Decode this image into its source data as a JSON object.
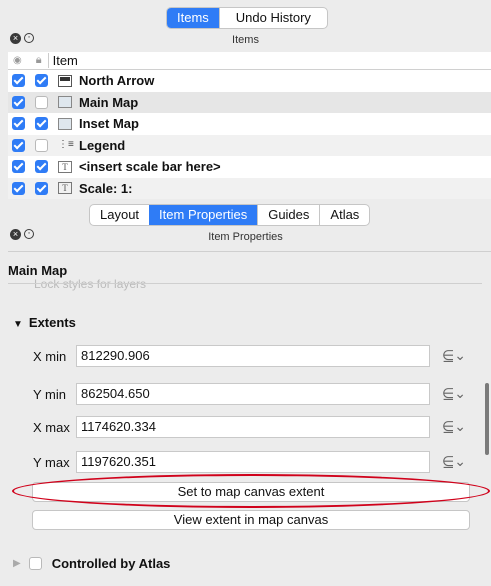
{
  "top_tabs": {
    "active": "Items",
    "other": "Undo History"
  },
  "items_panel": {
    "title": "Items",
    "column_item": "Item",
    "rows": [
      {
        "label": "North Arrow",
        "visible": true,
        "locked": true,
        "icon": "north-arrow-icon"
      },
      {
        "label": "Main Map",
        "visible": true,
        "locked": false,
        "icon": "map-icon"
      },
      {
        "label": "Inset Map",
        "visible": true,
        "locked": true,
        "icon": "map-icon"
      },
      {
        "label": "Legend",
        "visible": true,
        "locked": false,
        "icon": "legend-icon"
      },
      {
        "label": "<insert scale bar here>",
        "visible": true,
        "locked": true,
        "icon": "text-icon"
      },
      {
        "label": "Scale: 1:",
        "visible": true,
        "locked": true,
        "icon": "text-icon"
      }
    ]
  },
  "bottom_tabs": {
    "layout": "Layout",
    "item_properties": "Item Properties",
    "guides": "Guides",
    "atlas": "Atlas"
  },
  "properties_panel": {
    "title": "Item Properties",
    "section": "Main Map",
    "faded_option": "Lock styles for layers",
    "extents_heading": "Extents",
    "fields": [
      {
        "label": "X min",
        "value": "812290.906"
      },
      {
        "label": "Y min",
        "value": "862504.650"
      },
      {
        "label": "X max",
        "value": "1174620.334"
      },
      {
        "label": "Y max",
        "value": "1197620.351"
      }
    ],
    "set_extent_button": "Set to map canvas extent",
    "view_extent_button": "View extent in map canvas",
    "controlled_by_atlas": "Controlled by Atlas"
  },
  "colors": {
    "accent": "#2f7cf6",
    "highlight_ellipse": "#d0021b"
  }
}
